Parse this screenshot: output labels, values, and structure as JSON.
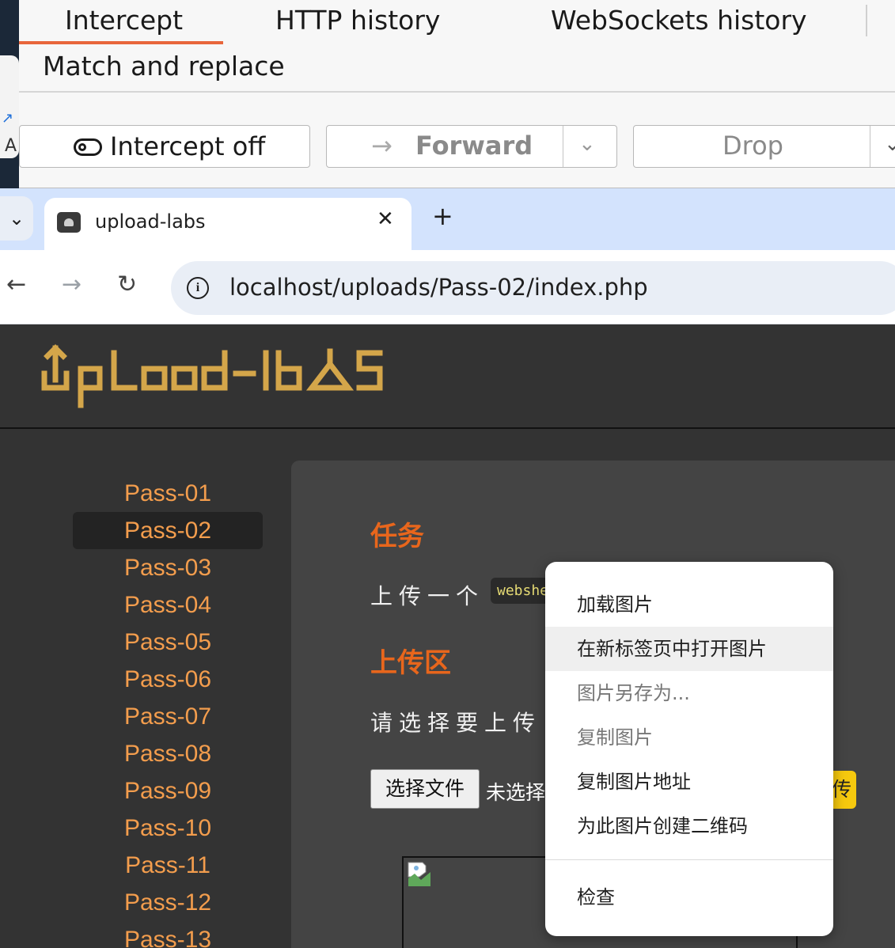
{
  "desktop": {
    "partial_letter": "A"
  },
  "burp": {
    "tabs": [
      "Intercept",
      "HTTP history",
      "WebSockets history"
    ],
    "second_row_tab": "Match and replace",
    "intercept_button": "Intercept off",
    "forward_button": "Forward",
    "drop_button": "Drop",
    "accent_color": "#e8663c"
  },
  "browser": {
    "tab_title": "upload-labs",
    "new_tab": "+",
    "close_tab": "✕",
    "url": "localhost/uploads/Pass-02/index.php"
  },
  "page": {
    "logo_text": "UpLoad-labs",
    "logo_color": "#d4a64a",
    "nav": [
      "Pass-01",
      "Pass-02",
      "Pass-03",
      "Pass-04",
      "Pass-05",
      "Pass-06",
      "Pass-07",
      "Pass-08",
      "Pass-09",
      "Pass-10",
      "Pass-11",
      "Pass-12",
      "Pass-13"
    ],
    "active_nav": "Pass-02",
    "task_title": "任务",
    "task_text_prefix": "上传一个",
    "task_code": "webshe",
    "upload_title": "上传区",
    "choose_text": "请选择要上传",
    "file_button": "选择文件",
    "no_file_text": "未选择",
    "upload_button_partial": "传"
  },
  "context_menu": {
    "items": [
      "加载图片",
      "在新标签页中打开图片",
      "图片另存为...",
      "复制图片",
      "复制图片地址",
      "为此图片创建二维码"
    ],
    "inspect": "检查",
    "hovered_item": "在新标签页中打开图片",
    "disabled_items": [
      "图片另存为...",
      "复制图片"
    ]
  }
}
